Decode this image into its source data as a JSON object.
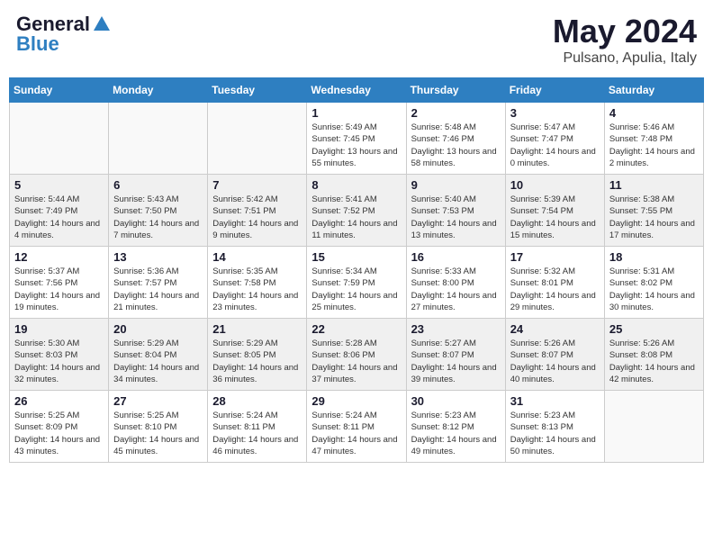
{
  "header": {
    "logo_line1": "General",
    "logo_line2": "Blue",
    "month": "May 2024",
    "location": "Pulsano, Apulia, Italy"
  },
  "weekdays": [
    "Sunday",
    "Monday",
    "Tuesday",
    "Wednesday",
    "Thursday",
    "Friday",
    "Saturday"
  ],
  "weeks": [
    [
      {
        "day": "",
        "empty": true
      },
      {
        "day": "",
        "empty": true
      },
      {
        "day": "",
        "empty": true
      },
      {
        "day": "1",
        "sunrise": "5:49 AM",
        "sunset": "7:45 PM",
        "daylight": "13 hours and 55 minutes."
      },
      {
        "day": "2",
        "sunrise": "5:48 AM",
        "sunset": "7:46 PM",
        "daylight": "13 hours and 58 minutes."
      },
      {
        "day": "3",
        "sunrise": "5:47 AM",
        "sunset": "7:47 PM",
        "daylight": "14 hours and 0 minutes."
      },
      {
        "day": "4",
        "sunrise": "5:46 AM",
        "sunset": "7:48 PM",
        "daylight": "14 hours and 2 minutes."
      }
    ],
    [
      {
        "day": "5",
        "sunrise": "5:44 AM",
        "sunset": "7:49 PM",
        "daylight": "14 hours and 4 minutes."
      },
      {
        "day": "6",
        "sunrise": "5:43 AM",
        "sunset": "7:50 PM",
        "daylight": "14 hours and 7 minutes."
      },
      {
        "day": "7",
        "sunrise": "5:42 AM",
        "sunset": "7:51 PM",
        "daylight": "14 hours and 9 minutes."
      },
      {
        "day": "8",
        "sunrise": "5:41 AM",
        "sunset": "7:52 PM",
        "daylight": "14 hours and 11 minutes."
      },
      {
        "day": "9",
        "sunrise": "5:40 AM",
        "sunset": "7:53 PM",
        "daylight": "14 hours and 13 minutes."
      },
      {
        "day": "10",
        "sunrise": "5:39 AM",
        "sunset": "7:54 PM",
        "daylight": "14 hours and 15 minutes."
      },
      {
        "day": "11",
        "sunrise": "5:38 AM",
        "sunset": "7:55 PM",
        "daylight": "14 hours and 17 minutes."
      }
    ],
    [
      {
        "day": "12",
        "sunrise": "5:37 AM",
        "sunset": "7:56 PM",
        "daylight": "14 hours and 19 minutes."
      },
      {
        "day": "13",
        "sunrise": "5:36 AM",
        "sunset": "7:57 PM",
        "daylight": "14 hours and 21 minutes."
      },
      {
        "day": "14",
        "sunrise": "5:35 AM",
        "sunset": "7:58 PM",
        "daylight": "14 hours and 23 minutes."
      },
      {
        "day": "15",
        "sunrise": "5:34 AM",
        "sunset": "7:59 PM",
        "daylight": "14 hours and 25 minutes."
      },
      {
        "day": "16",
        "sunrise": "5:33 AM",
        "sunset": "8:00 PM",
        "daylight": "14 hours and 27 minutes."
      },
      {
        "day": "17",
        "sunrise": "5:32 AM",
        "sunset": "8:01 PM",
        "daylight": "14 hours and 29 minutes."
      },
      {
        "day": "18",
        "sunrise": "5:31 AM",
        "sunset": "8:02 PM",
        "daylight": "14 hours and 30 minutes."
      }
    ],
    [
      {
        "day": "19",
        "sunrise": "5:30 AM",
        "sunset": "8:03 PM",
        "daylight": "14 hours and 32 minutes."
      },
      {
        "day": "20",
        "sunrise": "5:29 AM",
        "sunset": "8:04 PM",
        "daylight": "14 hours and 34 minutes."
      },
      {
        "day": "21",
        "sunrise": "5:29 AM",
        "sunset": "8:05 PM",
        "daylight": "14 hours and 36 minutes."
      },
      {
        "day": "22",
        "sunrise": "5:28 AM",
        "sunset": "8:06 PM",
        "daylight": "14 hours and 37 minutes."
      },
      {
        "day": "23",
        "sunrise": "5:27 AM",
        "sunset": "8:07 PM",
        "daylight": "14 hours and 39 minutes."
      },
      {
        "day": "24",
        "sunrise": "5:26 AM",
        "sunset": "8:07 PM",
        "daylight": "14 hours and 40 minutes."
      },
      {
        "day": "25",
        "sunrise": "5:26 AM",
        "sunset": "8:08 PM",
        "daylight": "14 hours and 42 minutes."
      }
    ],
    [
      {
        "day": "26",
        "sunrise": "5:25 AM",
        "sunset": "8:09 PM",
        "daylight": "14 hours and 43 minutes."
      },
      {
        "day": "27",
        "sunrise": "5:25 AM",
        "sunset": "8:10 PM",
        "daylight": "14 hours and 45 minutes."
      },
      {
        "day": "28",
        "sunrise": "5:24 AM",
        "sunset": "8:11 PM",
        "daylight": "14 hours and 46 minutes."
      },
      {
        "day": "29",
        "sunrise": "5:24 AM",
        "sunset": "8:11 PM",
        "daylight": "14 hours and 47 minutes."
      },
      {
        "day": "30",
        "sunrise": "5:23 AM",
        "sunset": "8:12 PM",
        "daylight": "14 hours and 49 minutes."
      },
      {
        "day": "31",
        "sunrise": "5:23 AM",
        "sunset": "8:13 PM",
        "daylight": "14 hours and 50 minutes."
      },
      {
        "day": "",
        "empty": true
      }
    ]
  ]
}
